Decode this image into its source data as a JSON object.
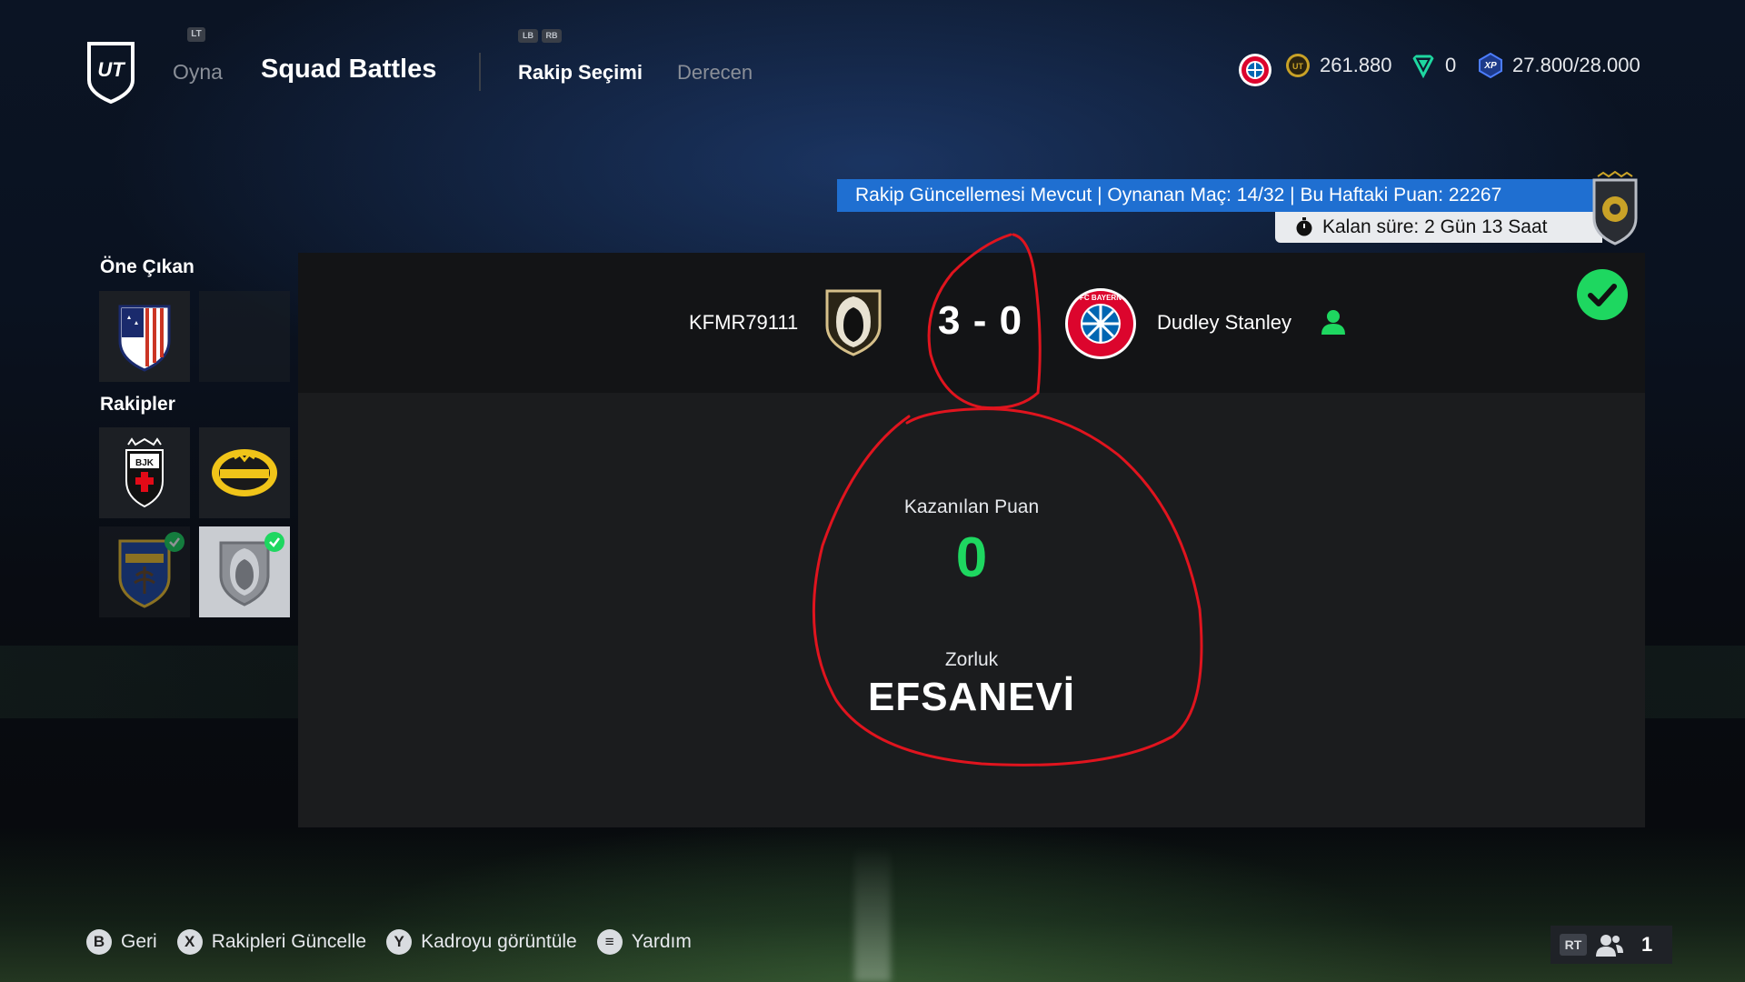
{
  "header": {
    "lt_hint": "LT",
    "nav_play": "Oyna",
    "title": "Squad Battles",
    "lb_hint": "LB",
    "rb_hint": "RB",
    "tab_active": "Rakip Seçimi",
    "tab_other": "Derecen",
    "coins": "261.880",
    "points": "0",
    "xp": "27.800/28.000",
    "xp_badge": "XP"
  },
  "info": {
    "banner": "Rakip Güncellemesi Mevcut | Oynanan Maç: 14/32 | Bu Haftaki Puan: 22267",
    "timer": "Kalan süre: 2 Gün 13 Saat"
  },
  "sidebar": {
    "featured_heading": "Öne Çıkan",
    "opponents_heading": "Rakipler"
  },
  "match": {
    "player_name": "KFMR79111",
    "score": "3 - 0",
    "opponent_name": "Dudley Stanley",
    "points_label": "Kazanılan Puan",
    "points_value": "0",
    "difficulty_label": "Zorluk",
    "difficulty_value": "EFSANEVİ"
  },
  "footer": {
    "back_key": "B",
    "back_label": "Geri",
    "refresh_key": "X",
    "refresh_label": "Rakipleri Güncelle",
    "view_key": "Y",
    "view_label": "Kadroyu görüntüle",
    "help_key": "≡",
    "help_label": "Yardım",
    "rt_key": "RT",
    "party_count": "1"
  },
  "colors": {
    "accent_blue": "#1f6fd1",
    "success_green": "#1ed760",
    "annotation_red": "#e0141e"
  }
}
